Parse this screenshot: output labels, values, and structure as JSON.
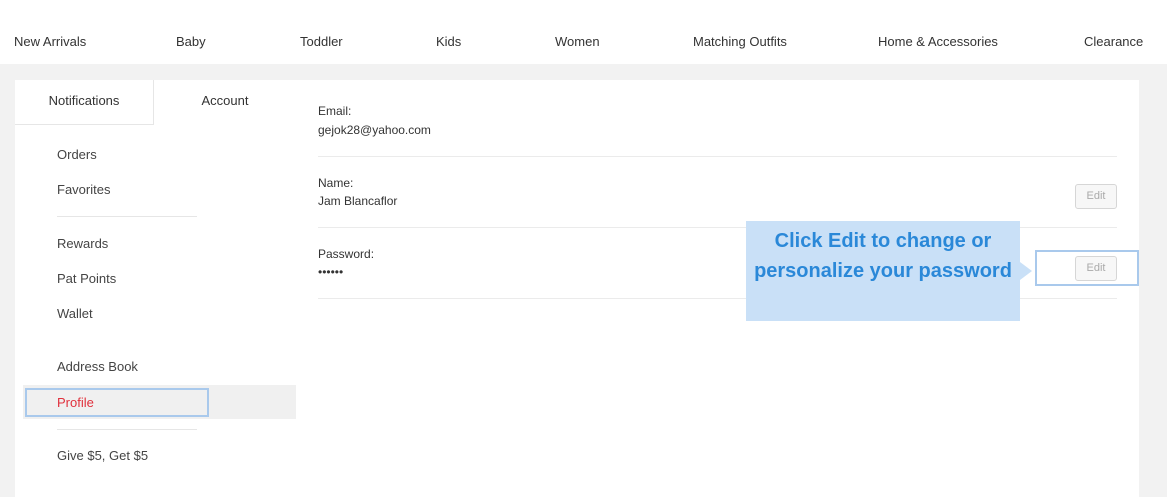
{
  "topnav": {
    "items": [
      "New Arrivals",
      "Baby",
      "Toddler",
      "Kids",
      "Women",
      "Matching Outfits",
      "Home & Accessories",
      "Clearance"
    ]
  },
  "sidebar": {
    "tabs": {
      "notifications": "Notifications",
      "account": "Account"
    },
    "items": {
      "orders": "Orders",
      "favorites": "Favorites",
      "rewards": "Rewards",
      "pat_points": "Pat Points",
      "wallet": "Wallet",
      "address_book": "Address Book",
      "profile": "Profile",
      "give_get": "Give $5, Get $5"
    }
  },
  "profile": {
    "email": {
      "label": "Email:",
      "value": "gejok28@yahoo.com"
    },
    "name": {
      "label": "Name:",
      "value": "Jam Blancaflor",
      "edit_label": "Edit"
    },
    "password": {
      "label": "Password:",
      "value": "••••••",
      "edit_label": "Edit"
    }
  },
  "callout": {
    "text": "Click Edit to change or personalize your password"
  },
  "colors": {
    "accent_red": "#e0303c",
    "highlight_blue": "#a9c9ec",
    "callout_bg": "#c9e0f7",
    "callout_text": "#2a88d8"
  }
}
